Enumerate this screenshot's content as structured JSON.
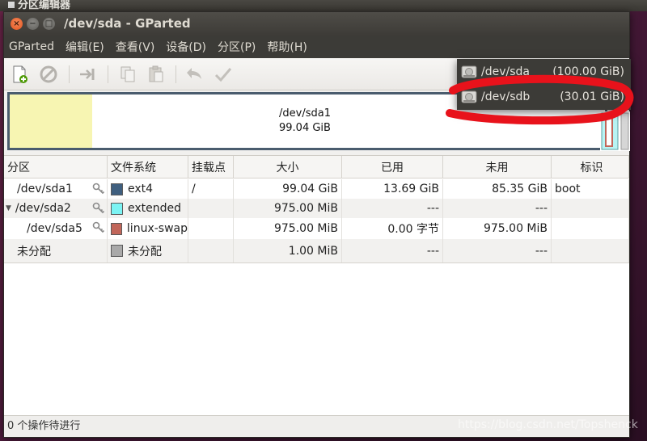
{
  "background_window": {
    "title": "分区编辑器"
  },
  "window": {
    "title": "/dev/sda - GParted",
    "controls": {
      "close": "×",
      "minimize": "−",
      "maximize": "□"
    }
  },
  "menubar": [
    "GParted",
    "编辑(E)",
    "查看(V)",
    "设备(D)",
    "分区(P)",
    "帮助(H)"
  ],
  "toolbar": {
    "icons": [
      "new-partition-icon",
      "delete-icon",
      "resize-move-icon",
      "copy-icon",
      "paste-icon",
      "undo-icon",
      "apply-icon"
    ]
  },
  "devices": {
    "items": [
      {
        "name": "/dev/sda",
        "size": "(100.00 GiB)"
      },
      {
        "name": "/dev/sdb",
        "size": "(30.01 GiB)"
      }
    ]
  },
  "graphic": {
    "selected_name": "/dev/sda1",
    "selected_size": "99.04 GiB",
    "colors": {
      "unused": "#f7f5b2",
      "border": "#4a5c6e"
    }
  },
  "table": {
    "headers": {
      "partition": "分区",
      "filesystem": "文件系统",
      "mountpoint": "挂载点",
      "size": "大小",
      "used": "已用",
      "unused": "未用",
      "flags": "标识"
    },
    "rows": [
      {
        "partition": "/dev/sda1",
        "filesystem": "ext4",
        "fs_color": "#3f5f7f",
        "mountpoint": "/",
        "size": "99.04 GiB",
        "used": "13.69 GiB",
        "unused": "85.35 GiB",
        "flags": "boot"
      },
      {
        "partition": "/dev/sda2",
        "filesystem": "extended",
        "fs_color": "#7cf4f4",
        "mountpoint": "",
        "size": "975.00 MiB",
        "used": "---",
        "unused": "---",
        "flags": ""
      },
      {
        "partition": "/dev/sda5",
        "filesystem": "linux-swap",
        "fs_color": "#c1665a",
        "mountpoint": "",
        "size": "975.00 MiB",
        "used": "0.00 字节",
        "unused": "975.00 MiB",
        "flags": ""
      },
      {
        "partition": "未分配",
        "filesystem": "未分配",
        "fs_color": "#a9a9a9",
        "mountpoint": "",
        "size": "1.00 MiB",
        "used": "---",
        "unused": "---",
        "flags": ""
      }
    ]
  },
  "statusbar": {
    "text": "0 个操作待进行"
  },
  "watermark": "https://blog.csdn.net/Topshenck",
  "colors": {
    "menubar_bg": "#3c3b37",
    "titlebar_bg": "#4f4d48",
    "annotation": "#e8121b",
    "desktop": "#4c1b3c"
  }
}
